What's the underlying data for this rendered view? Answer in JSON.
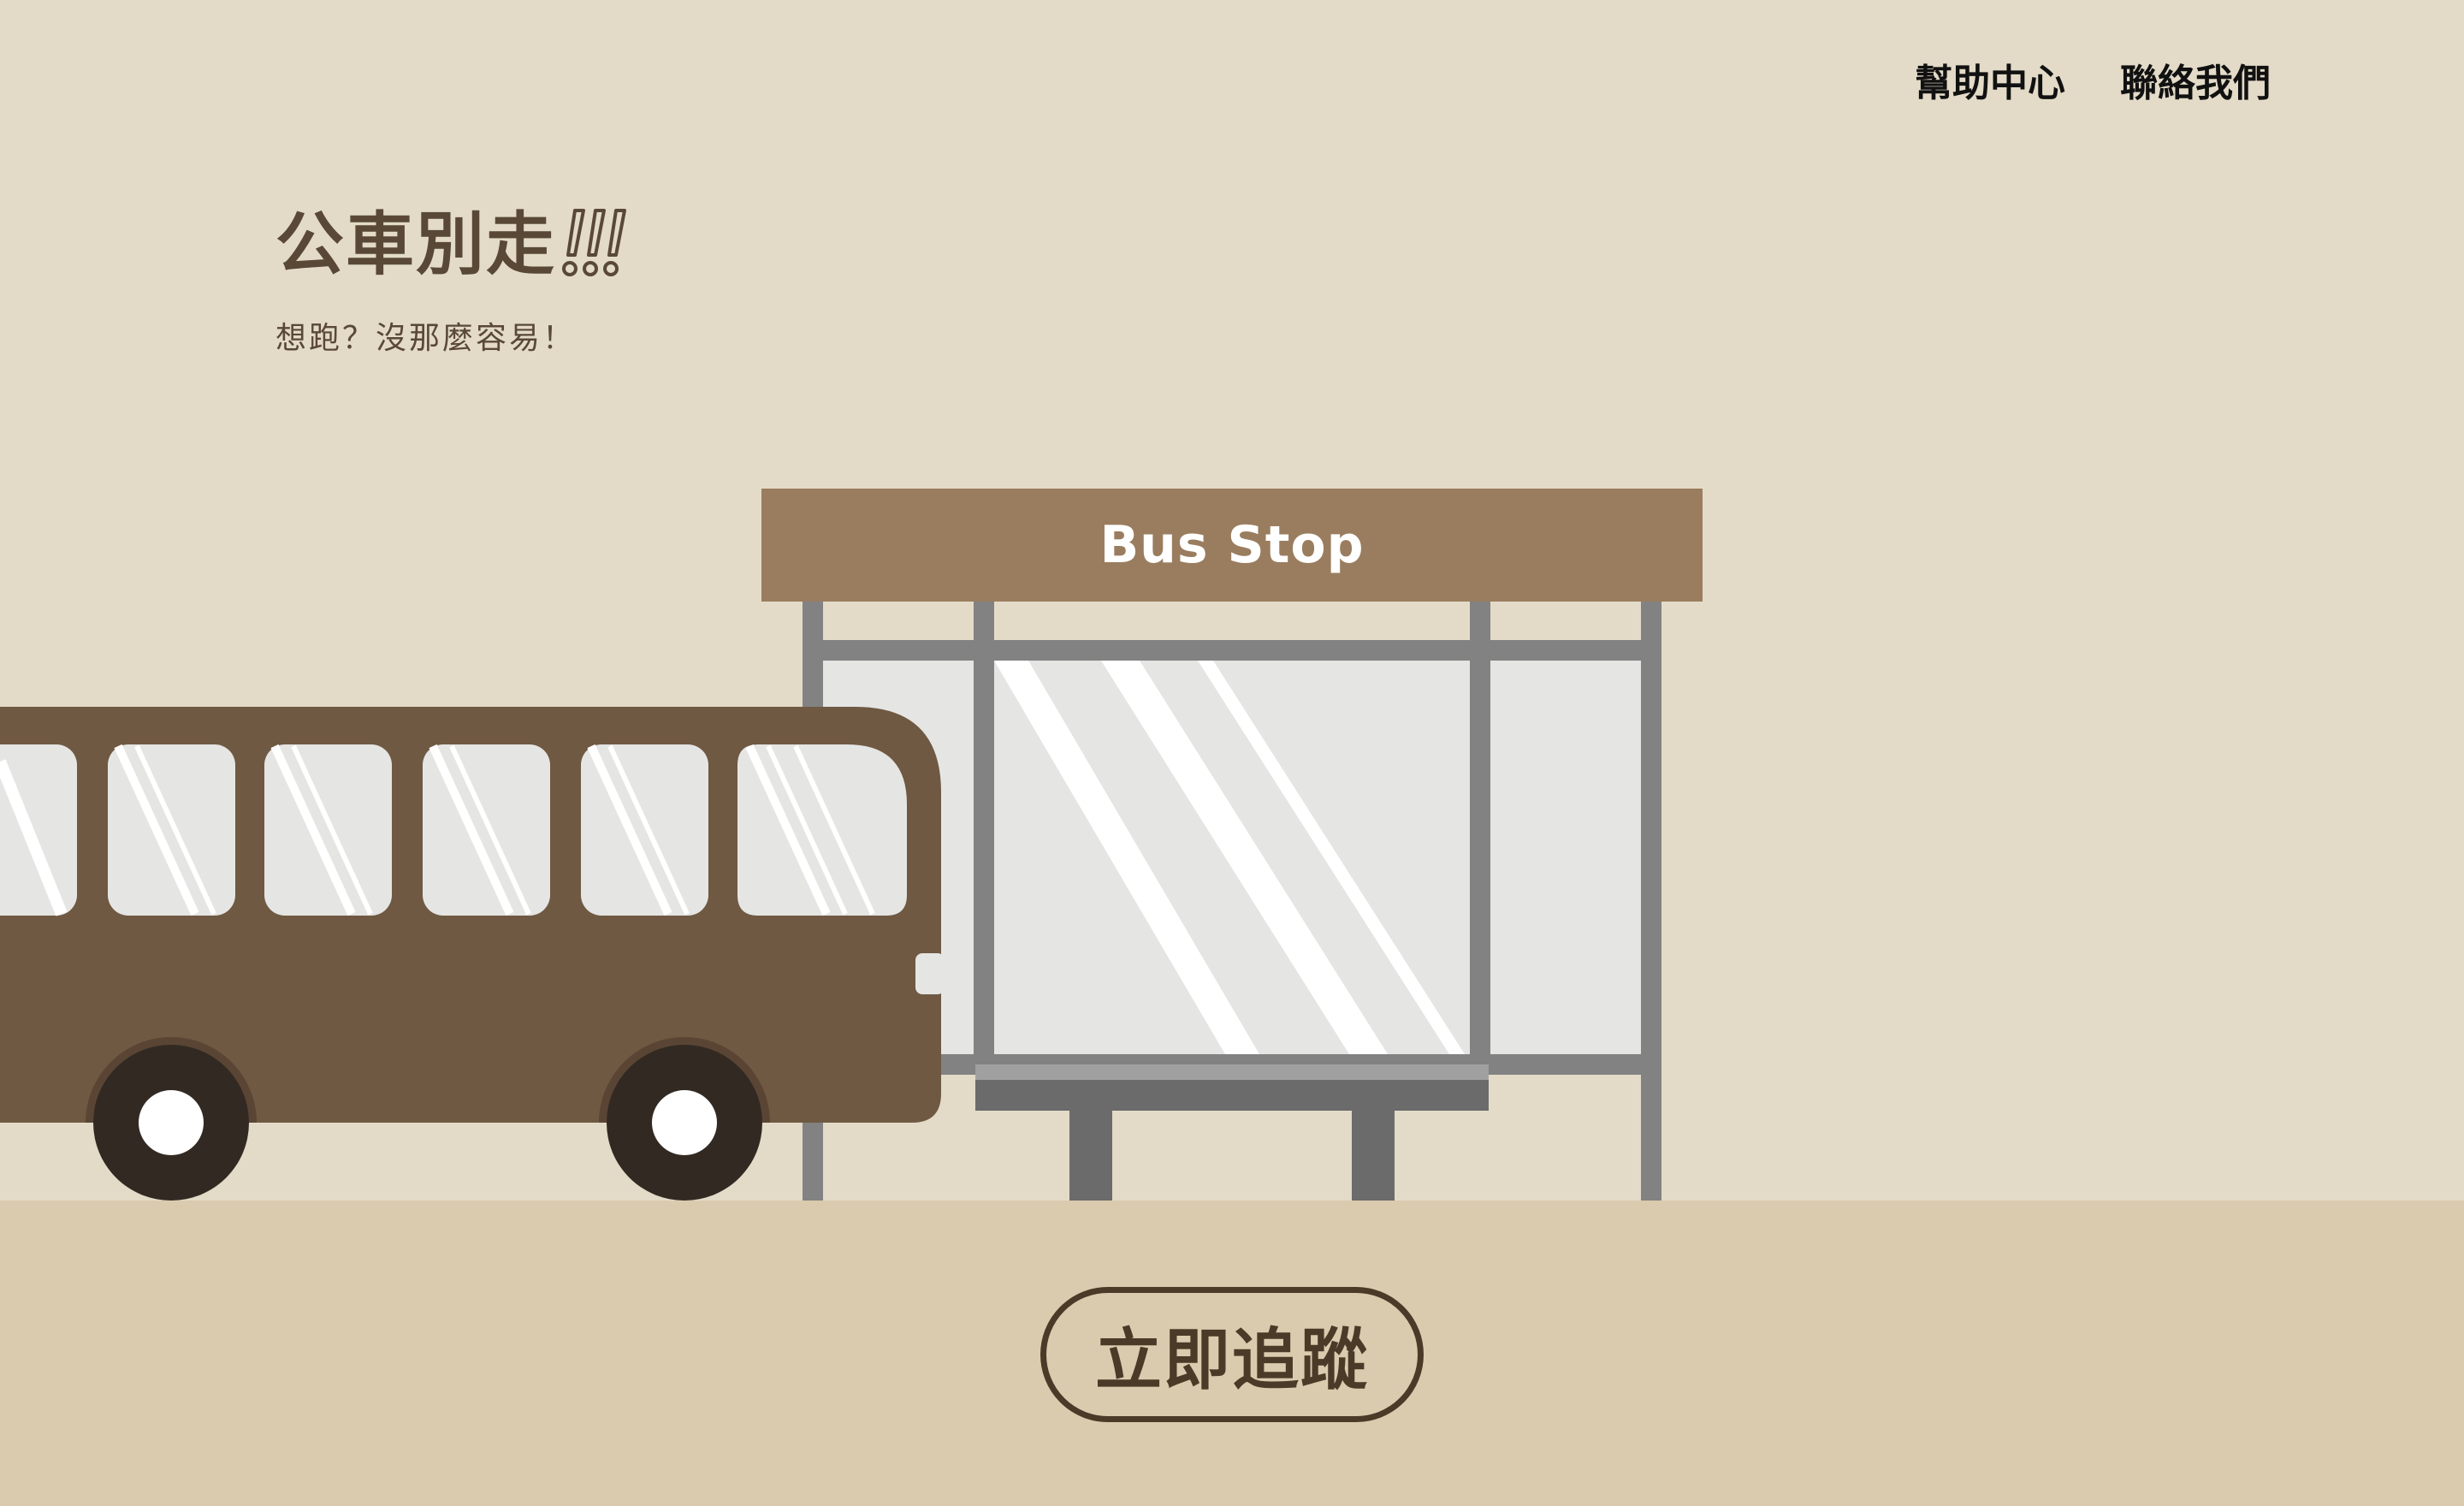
{
  "nav": {
    "help_label": "幫助中心",
    "contact_label": "聯絡我們"
  },
  "brand": {
    "title": "公車別走",
    "exclamation": "!!!",
    "subtitle": "想跑？沒那麼容易！"
  },
  "bus_stop": {
    "sign_label": "Bus Stop"
  },
  "cta": {
    "label": "立即追蹤"
  },
  "colors": {
    "background": "#e3dbc8",
    "ground": "#dacbae",
    "bus_body": "#6f5942",
    "sign": "#9a7d5f",
    "text_brown": "#5a4837"
  }
}
